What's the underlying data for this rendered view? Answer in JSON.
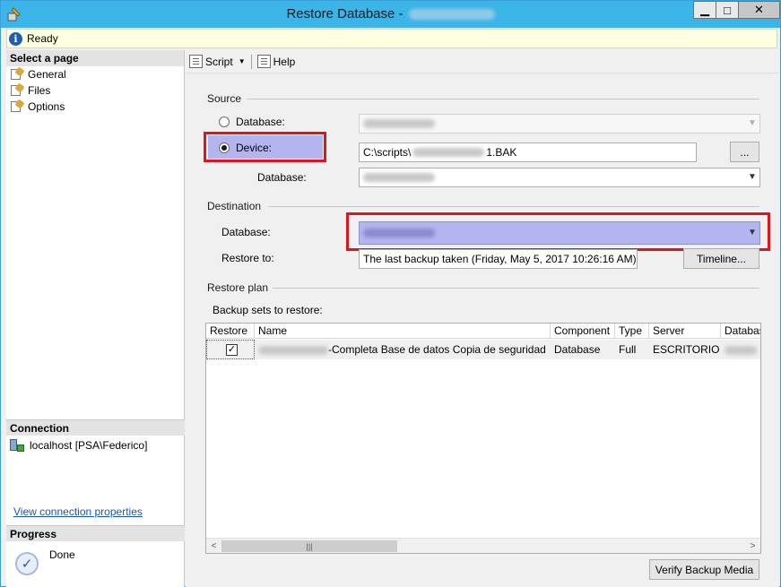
{
  "window": {
    "title": "Restore Database -",
    "controls": {
      "minimize": "▁",
      "maximize": "□",
      "close": "✕"
    }
  },
  "status": {
    "text": "Ready"
  },
  "sidebar": {
    "select_page_header": "Select a page",
    "pages": [
      {
        "label": "General"
      },
      {
        "label": "Files"
      },
      {
        "label": "Options"
      }
    ],
    "connection_header": "Connection",
    "connection_value": "localhost [PSA\\Federico]",
    "view_connection_link": "View connection properties",
    "progress_header": "Progress",
    "progress_value": "Done"
  },
  "toolbar": {
    "script_label": "Script",
    "help_label": "Help"
  },
  "source": {
    "group_label": "Source",
    "database_radio_label": "Database:",
    "device_radio_label": "Device:",
    "device_path_prefix": "C:\\scripts\\",
    "device_path_suffix": "1.BAK",
    "browse_label": "...",
    "database_label": "Database:",
    "selected_option": "device"
  },
  "destination": {
    "group_label": "Destination",
    "database_label": "Database:",
    "restore_to_label": "Restore to:",
    "restore_to_value": "The last backup taken (Friday, May 5, 2017 10:26:16 AM)",
    "timeline_label": "Timeline..."
  },
  "restore_plan": {
    "group_label": "Restore plan",
    "backup_sets_label": "Backup sets to restore:",
    "columns": [
      "Restore",
      "Name",
      "Component",
      "Type",
      "Server",
      "Databas"
    ],
    "rows": [
      {
        "restore": true,
        "name_suffix": "-Completa Base de datos Copia de seguridad",
        "component": "Database",
        "type": "Full",
        "server": "ESCRITORIO"
      }
    ],
    "scroll_left": "<",
    "scroll_thumb": "|||",
    "scroll_right": ">"
  },
  "footer": {
    "verify_label": "Verify Backup Media"
  },
  "colors": {
    "titlebar": "#3bb4e7",
    "highlight_red": "#e0141e",
    "highlight_blue": "#b4b4f0"
  }
}
